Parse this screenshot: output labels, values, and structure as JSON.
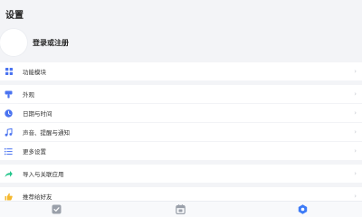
{
  "header": {
    "title": "设置"
  },
  "profile": {
    "login_label": "登录或注册"
  },
  "sections": {
    "features": {
      "label": "功能模块",
      "icon": "grid-icon"
    },
    "appearance": {
      "label": "外观",
      "icon": "brush-icon"
    },
    "datetime": {
      "label": "日期与时间",
      "icon": "clock-icon"
    },
    "sound": {
      "label": "声音、提醒与通知",
      "icon": "music-note-icon"
    },
    "more": {
      "label": "更多设置",
      "icon": "list-settings-icon"
    },
    "import": {
      "label": "导入与关联应用",
      "icon": "share-arrow-icon"
    },
    "recommend": {
      "label": "推荐给好友",
      "icon": "thumbs-up-icon"
    }
  },
  "tabs": [
    {
      "icon": "checkbox-icon"
    },
    {
      "icon": "calendar-icon"
    },
    {
      "icon": "settings-hex-icon",
      "active": true
    }
  ],
  "colors": {
    "accent": "#3d7bf7",
    "icon_blue": "#4a73f0",
    "icon_green": "#22c58b",
    "icon_orange": "#f5b82e",
    "background": "#f3f4f7"
  }
}
